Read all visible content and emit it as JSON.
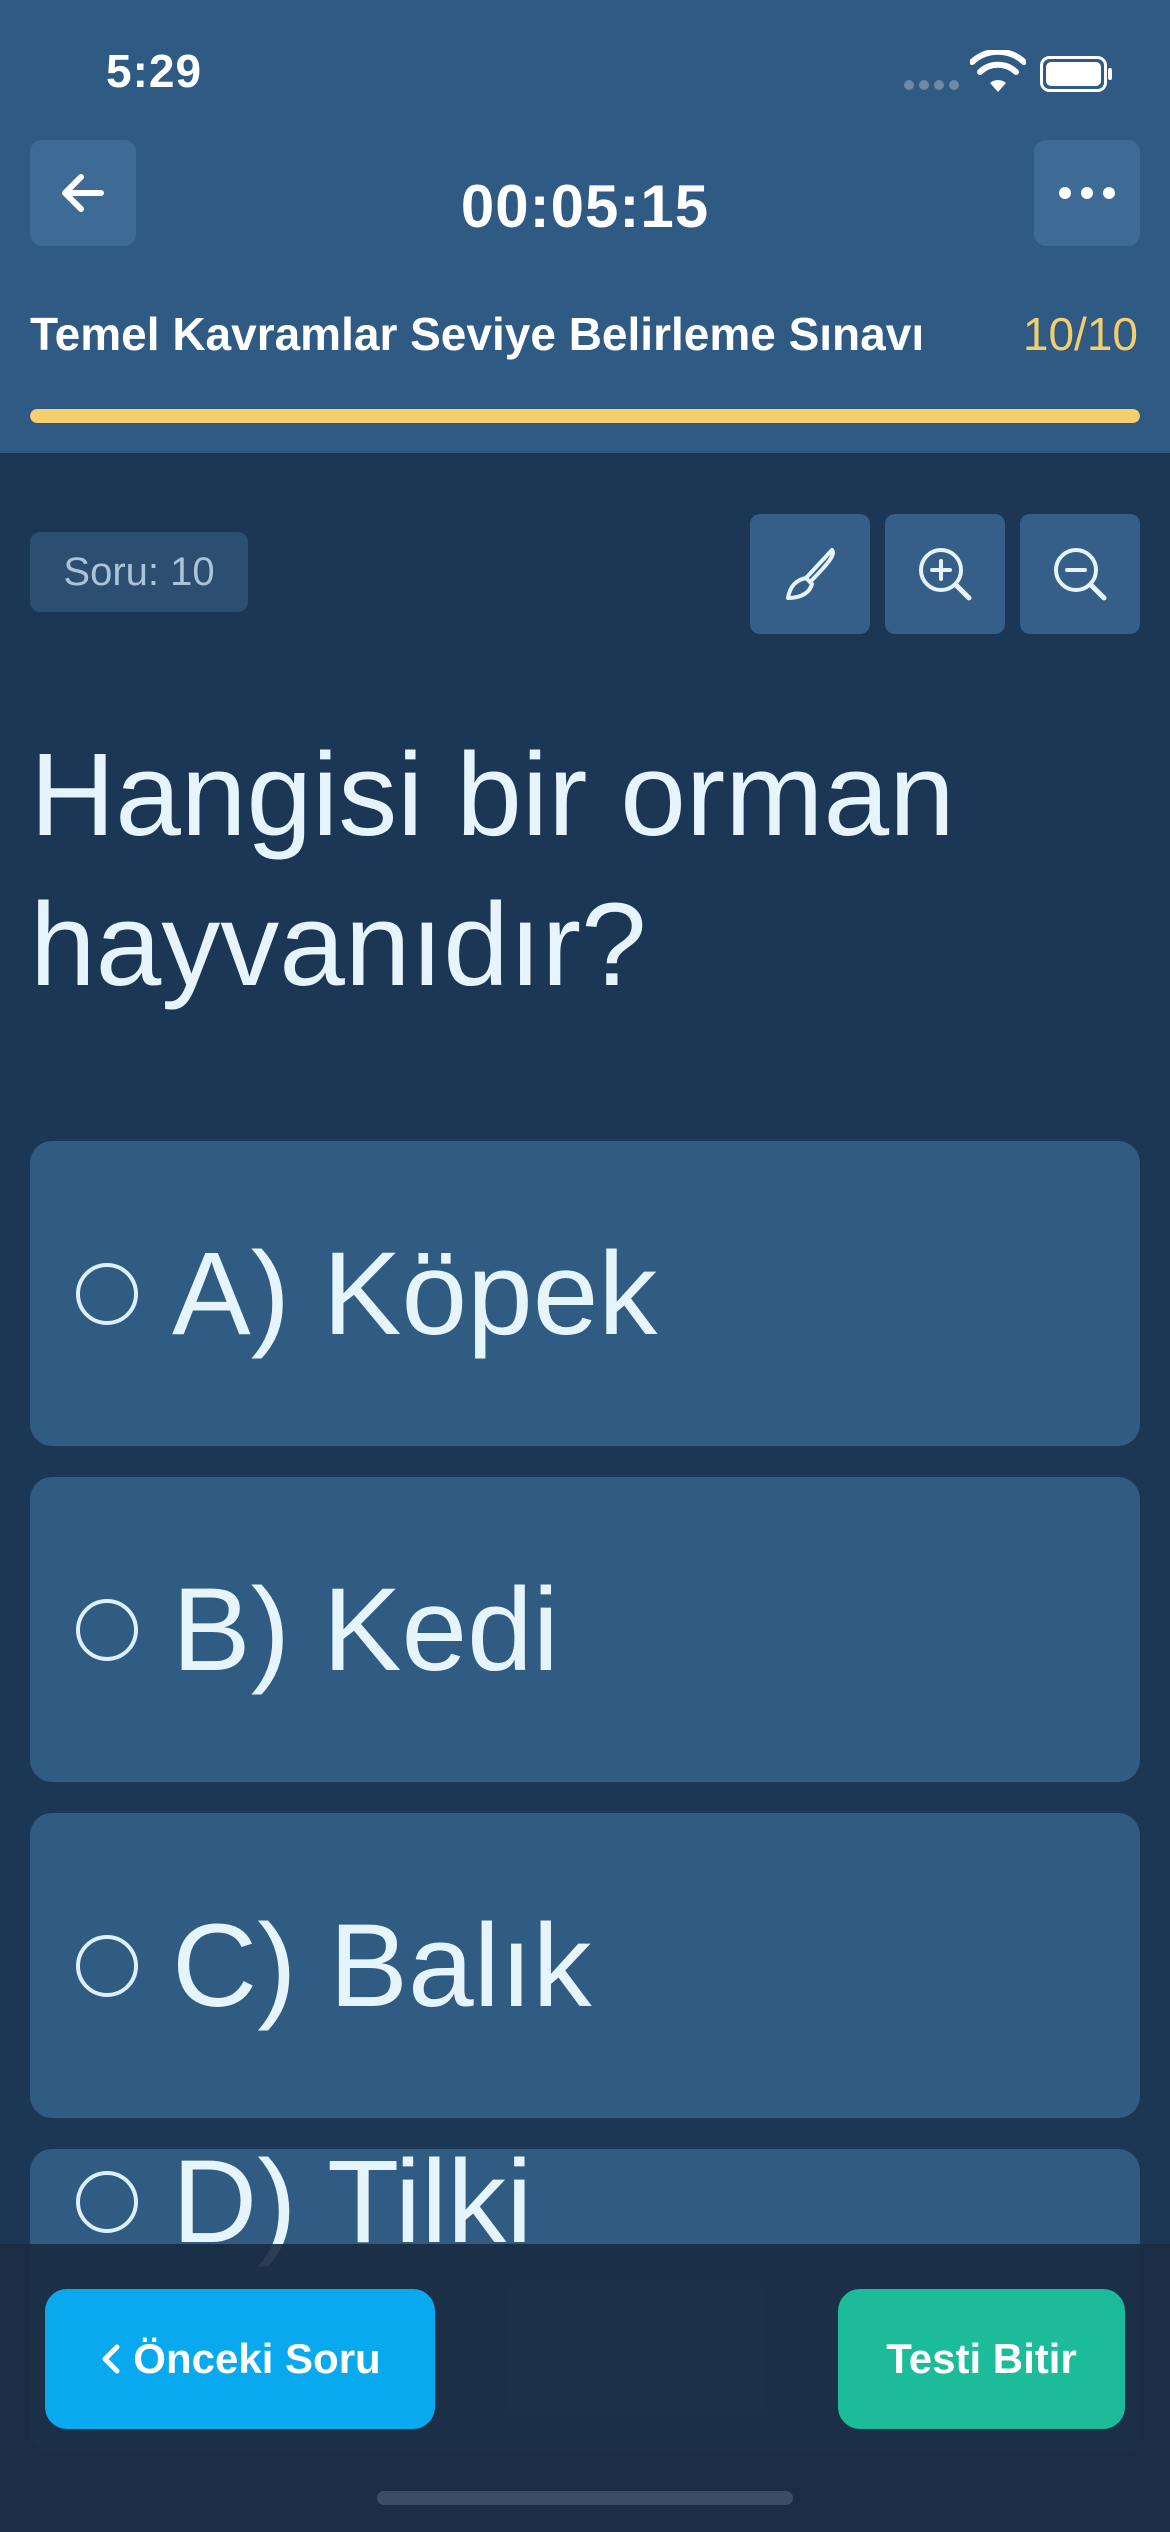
{
  "status_bar": {
    "time": "5:29",
    "icons": [
      "cellular-signal-icon",
      "wifi-icon",
      "battery-icon"
    ]
  },
  "header": {
    "timer": "00:05:15",
    "exam_title": "Temel Kavramlar Seviye Belirleme Sınavı",
    "progress_text": "10/10",
    "progress_fraction": 1.0,
    "back_icon": "arrow-left-icon",
    "more_icon": "ellipsis-icon"
  },
  "toolbar": {
    "question_badge": "Soru: 10",
    "tools": [
      "brush-icon",
      "zoom-in-icon",
      "zoom-out-icon"
    ]
  },
  "question": {
    "text": "Hangisi bir orman hayvanıdır?"
  },
  "options": [
    {
      "label": "A) Köpek"
    },
    {
      "label": "B) Kedi"
    },
    {
      "label": "C) Balık"
    },
    {
      "label": "D) Tilki"
    }
  ],
  "footer": {
    "prev_label": "Önceki Soru",
    "finish_label": "Testi Bitir"
  },
  "colors": {
    "header_bg": "#2e5a84",
    "page_bg": "#1c3656",
    "progress_fill": "#f6cf6e",
    "progress_text": "#f4cd6c",
    "option_bg": "#305b83",
    "prev_button": "#08a9ee",
    "finish_button": "#1cbc9b"
  }
}
